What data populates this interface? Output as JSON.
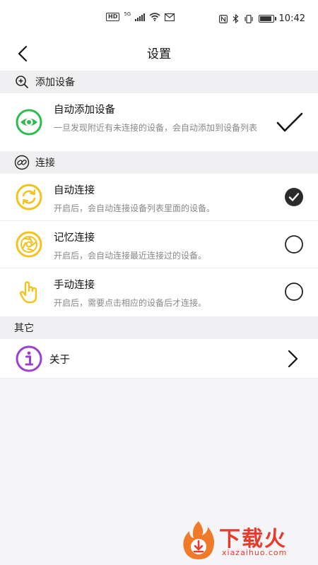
{
  "status_bar": {
    "hd": "HD",
    "network": "5G",
    "time": "10:42"
  },
  "header": {
    "title": "设置"
  },
  "sections": {
    "add_device": {
      "label": "添加设备",
      "icon": "zoom-in-icon"
    },
    "connect": {
      "label": "连接",
      "icon": "link-icon"
    },
    "other": {
      "label": "其它"
    }
  },
  "auto_add": {
    "title": "自动添加设备",
    "desc": "一旦发现附近有未连接的设备，会自动添加到设备列表",
    "checked": true
  },
  "connect_options": [
    {
      "title": "自动连接",
      "desc": "开启后，会自动连接设备列表里面的设备。",
      "selected": true,
      "icon": "sync-icon"
    },
    {
      "title": "记忆连接",
      "desc": "开启后，会自动连接最近连接过的设备。",
      "selected": false,
      "icon": "aperture-icon"
    },
    {
      "title": "手动连接",
      "desc": "开启后，需要点击相应的设备后才连接。",
      "selected": false,
      "icon": "hand-pointer-icon"
    }
  ],
  "about": {
    "label": "关于",
    "icon": "info-icon"
  },
  "colors": {
    "green": "#2dbb4f",
    "yellow": "#f3c21b",
    "purple": "#9b3fcf",
    "watermark": "#e83a2a"
  },
  "watermark": {
    "brand": "下载火",
    "domain": "xiazaihuo.com"
  }
}
